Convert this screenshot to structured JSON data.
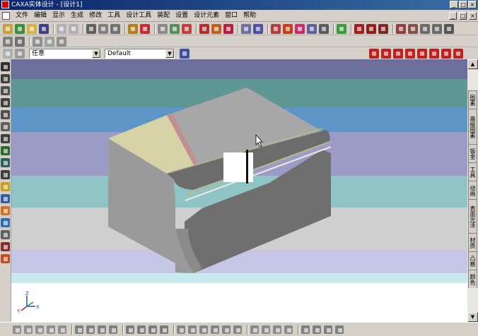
{
  "window": {
    "title": "CAXA实体设计 - [设计1]",
    "min_label": "_",
    "max_label": "□",
    "close_label": "×",
    "mdi_min_label": "_",
    "mdi_restore_label": "□",
    "mdi_close_label": "×"
  },
  "menu": [
    "文件",
    "编辑",
    "显示",
    "生成",
    "修改",
    "工具",
    "设计工具",
    "装配",
    "设置",
    "设计元素",
    "窗口",
    "帮助"
  ],
  "toolbar3": {
    "filter_value": "任意",
    "style_value": "Default",
    "dropdown_arrow": "▼"
  },
  "scroll": {
    "up_arrow": "▲",
    "down_arrow": "▼"
  },
  "right_tabs": [
    "图素",
    "高级图素",
    "钣金",
    "工具",
    "动画",
    "表面光泽",
    "材质",
    "凸痕",
    "颜色"
  ],
  "axis_triad": {
    "x": "X",
    "y": "Y",
    "z": "Z"
  },
  "colors": {
    "title_bar_start": "#0a246a",
    "title_bar_end": "#3a6ea5",
    "ui_face": "#d4d0c8",
    "background_bands": [
      "#6c6e9c",
      "#5f9795",
      "#5d96c6",
      "#9b9bc5",
      "#8fc4c6",
      "#cfcfcf",
      "#c5c6e6",
      "#c7eaee",
      "#ffffff"
    ],
    "part_top": "#a7a7a7",
    "part_front": "#999999",
    "part_right": "#6f6f6f",
    "part_fillet": "#6c6c6c",
    "part_face_yellow": "#d6d2a6",
    "part_stripe_pink": "#c08f90"
  }
}
